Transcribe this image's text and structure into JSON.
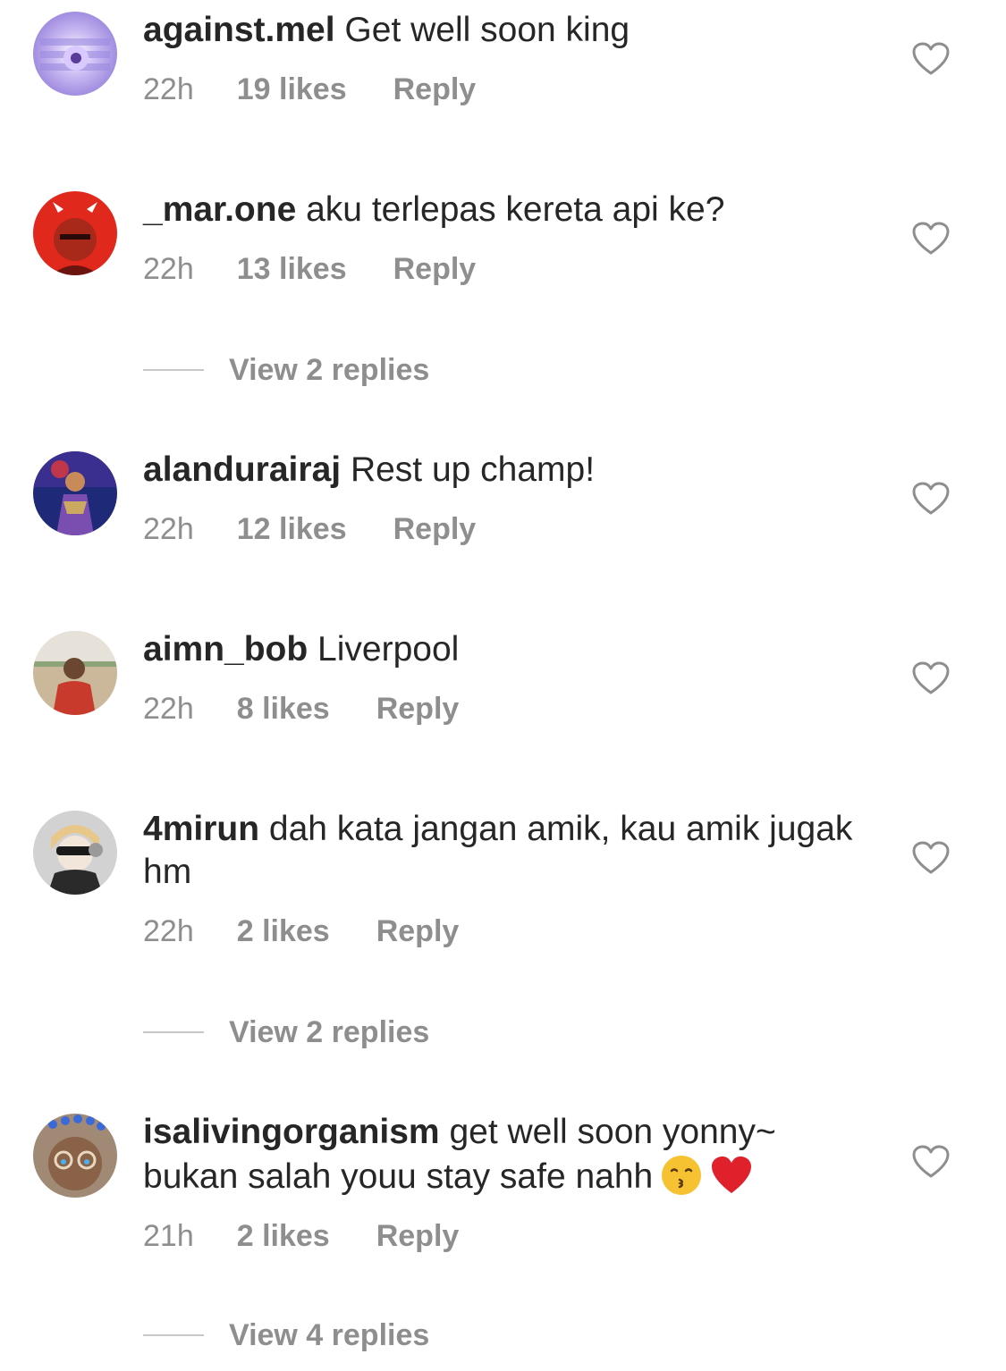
{
  "comments": [
    {
      "username": "against.mel",
      "text": "Get well soon king",
      "time": "22h",
      "likes": "19 likes",
      "reply": "Reply",
      "avatar_color": "#b9a7e8"
    },
    {
      "username": "_mar.one",
      "text": "aku terlepas kereta api ke?",
      "time": "22h",
      "likes": "13 likes",
      "reply": "Reply",
      "view_replies": "View 2 replies",
      "avatar_color": "#e0281c"
    },
    {
      "username": "alandurairaj",
      "text": "Rest up champ!",
      "time": "22h",
      "likes": "12 likes",
      "reply": "Reply",
      "avatar_color": "#2b3f9c"
    },
    {
      "username": "aimn_bob",
      "text": "Liverpool",
      "time": "22h",
      "likes": "8 likes",
      "reply": "Reply",
      "avatar_color": "#b8a27a"
    },
    {
      "username": "4mirun",
      "text": "dah kata jangan amik, kau amik jugak hm",
      "time": "22h",
      "likes": "2 likes",
      "reply": "Reply",
      "view_replies": "View 2 replies",
      "avatar_color": "#c8c8c8"
    },
    {
      "username": "isalivingorganism",
      "text": "get well soon yonny~ bukan salah youu stay safe nahh",
      "emojis": [
        "kissing-face-emoji",
        "red-heart-emoji"
      ],
      "time": "21h",
      "likes": "2 likes",
      "reply": "Reply",
      "view_replies": "View 4 replies",
      "avatar_color": "#8a6a52"
    }
  ],
  "icons": {
    "like": "heart-outline-icon"
  },
  "colors": {
    "text": "#262626",
    "secondary": "#8e8e8e",
    "heart_emoji": "#e0202b",
    "kiss_emoji": "#f7c232"
  }
}
